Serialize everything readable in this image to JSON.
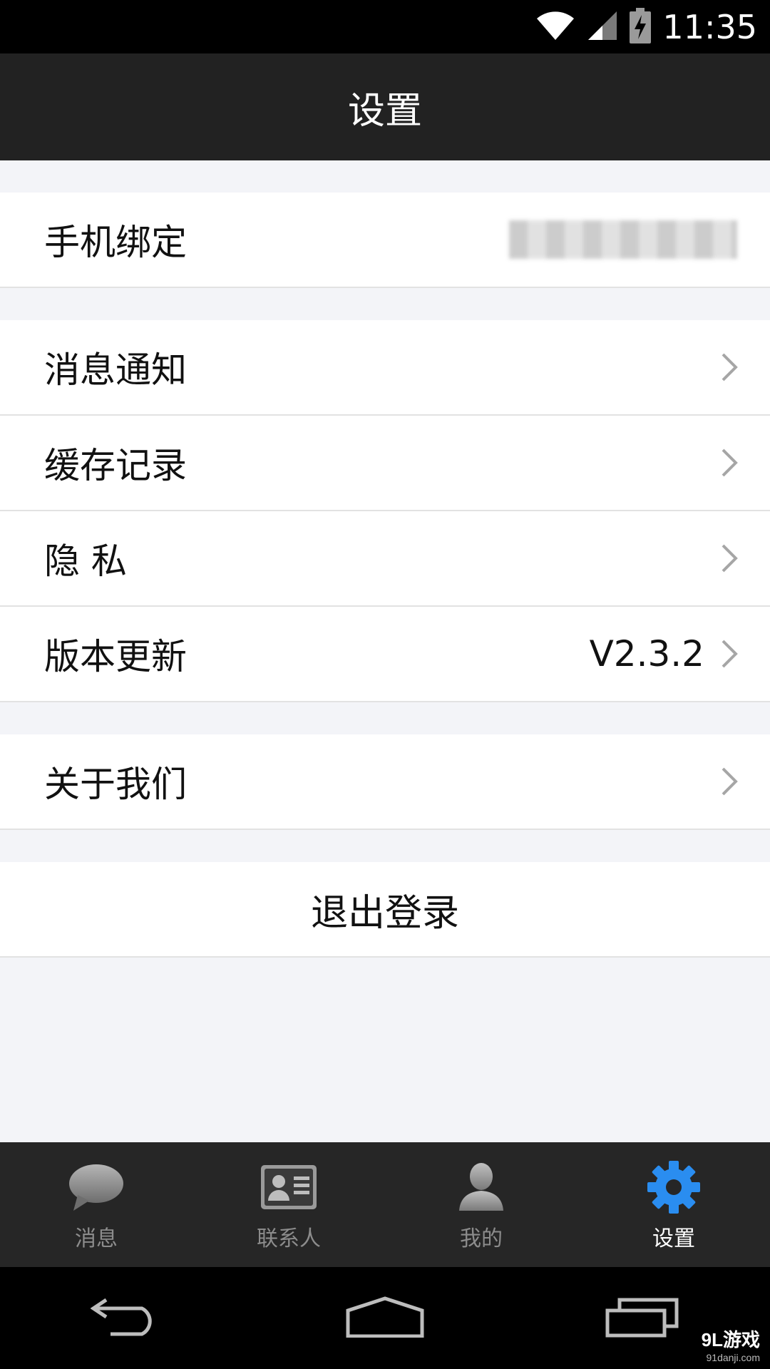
{
  "status_bar": {
    "time": "11:35"
  },
  "header": {
    "title": "设置"
  },
  "settings": {
    "phone_binding": {
      "label": "手机绑定"
    },
    "notifications": {
      "label": "消息通知"
    },
    "cache": {
      "label": "缓存记录"
    },
    "privacy": {
      "label": "隐 私"
    },
    "version": {
      "label": "版本更新",
      "value": "V2.3.2"
    },
    "about": {
      "label": "关于我们"
    },
    "logout": {
      "label": "退出登录"
    }
  },
  "tabs": [
    {
      "label": "消息",
      "icon": "chat-bubble-icon",
      "active": false
    },
    {
      "label": "联系人",
      "icon": "contact-card-icon",
      "active": false
    },
    {
      "label": "我的",
      "icon": "person-icon",
      "active": false
    },
    {
      "label": "设置",
      "icon": "gear-icon",
      "active": true
    }
  ],
  "watermark": {
    "logo": "9L游戏",
    "url": "91danji.com"
  },
  "colors": {
    "accent": "#2a8df0",
    "header_bg": "#222222",
    "page_bg": "#f3f4f8",
    "tab_inactive": "#8c8c8c"
  }
}
